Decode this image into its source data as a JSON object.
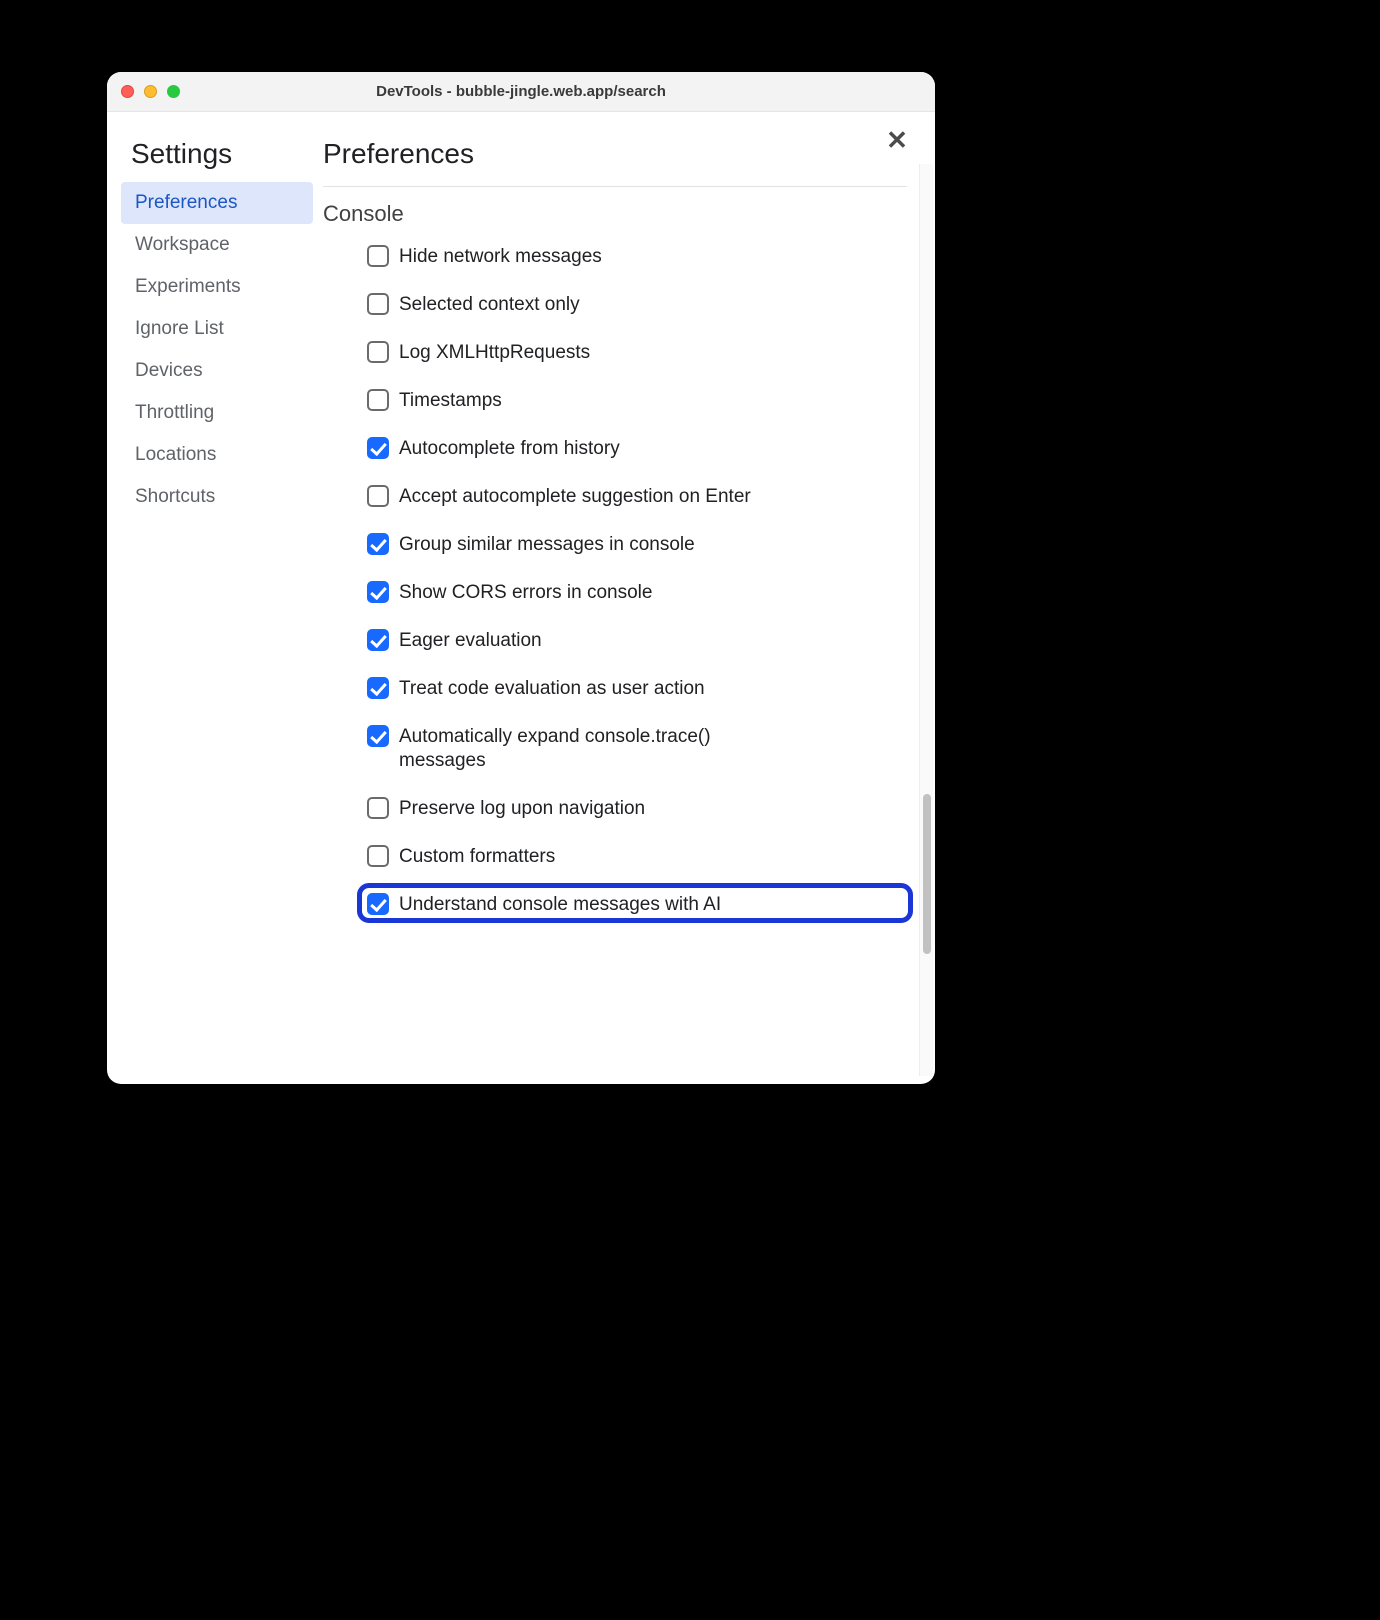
{
  "window": {
    "title": "DevTools - bubble-jingle.web.app/search"
  },
  "sidebar": {
    "title": "Settings",
    "items": [
      {
        "label": "Preferences",
        "selected": true
      },
      {
        "label": "Workspace",
        "selected": false
      },
      {
        "label": "Experiments",
        "selected": false
      },
      {
        "label": "Ignore List",
        "selected": false
      },
      {
        "label": "Devices",
        "selected": false
      },
      {
        "label": "Throttling",
        "selected": false
      },
      {
        "label": "Locations",
        "selected": false
      },
      {
        "label": "Shortcuts",
        "selected": false
      }
    ]
  },
  "main": {
    "title": "Preferences",
    "section": "Console",
    "options": [
      {
        "label": "Hide network messages",
        "checked": false,
        "highlighted": false
      },
      {
        "label": "Selected context only",
        "checked": false,
        "highlighted": false
      },
      {
        "label": "Log XMLHttpRequests",
        "checked": false,
        "highlighted": false
      },
      {
        "label": "Timestamps",
        "checked": false,
        "highlighted": false
      },
      {
        "label": "Autocomplete from history",
        "checked": true,
        "highlighted": false
      },
      {
        "label": "Accept autocomplete suggestion on Enter",
        "checked": false,
        "highlighted": false
      },
      {
        "label": "Group similar messages in console",
        "checked": true,
        "highlighted": false
      },
      {
        "label": "Show CORS errors in console",
        "checked": true,
        "highlighted": false
      },
      {
        "label": "Eager evaluation",
        "checked": true,
        "highlighted": false
      },
      {
        "label": "Treat code evaluation as user action",
        "checked": true,
        "highlighted": false
      },
      {
        "label": "Automatically expand console.trace() messages",
        "checked": true,
        "highlighted": false
      },
      {
        "label": "Preserve log upon navigation",
        "checked": false,
        "highlighted": false
      },
      {
        "label": "Custom formatters",
        "checked": false,
        "highlighted": false
      },
      {
        "label": "Understand console messages with AI",
        "checked": true,
        "highlighted": true
      }
    ]
  }
}
